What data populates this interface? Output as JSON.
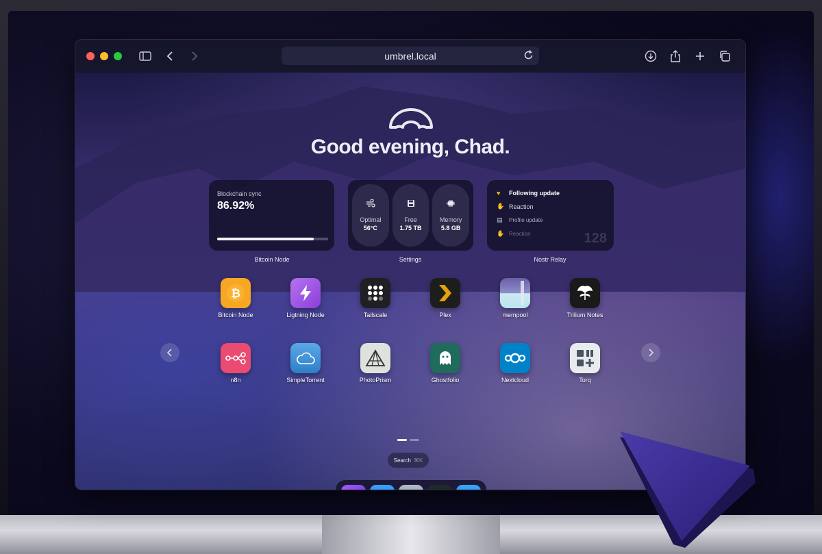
{
  "browser": {
    "url": "umbrel.local"
  },
  "greeting": "Good evening, Chad.",
  "widgets": {
    "bitcoin": {
      "label": "Blockchain sync",
      "value": "86.92%",
      "progress": 0.8692,
      "caption": "Bitcoin Node"
    },
    "settings": {
      "caption": "Settings",
      "pills": [
        {
          "label": "Optimal",
          "value": "56°C",
          "icon": "fan-icon"
        },
        {
          "label": "Free",
          "value": "1.75 TB",
          "icon": "disk-icon"
        },
        {
          "label": "Memory",
          "value": "5.8 GB",
          "icon": "memory-icon"
        }
      ]
    },
    "nostr": {
      "caption": "Nostr Relay",
      "count": "128",
      "items": [
        {
          "label": "Following update",
          "icon": "heart-icon"
        },
        {
          "label": "Reaction",
          "icon": "thumbs-up-icon"
        },
        {
          "label": "Profile update",
          "icon": "document-icon"
        },
        {
          "label": "Reaction",
          "icon": "thumbs-up-icon"
        }
      ]
    }
  },
  "apps": [
    {
      "name": "Bitcoin Node",
      "icon": "bitcoin-icon",
      "color": "#f7a723"
    },
    {
      "name": "Ligtning Node",
      "icon": "lightning-icon",
      "color": "#a25ae6"
    },
    {
      "name": "Tailscale",
      "icon": "tailscale-icon",
      "color": "#1f1f24"
    },
    {
      "name": "Plex",
      "icon": "plex-icon",
      "color": "#1d1d1d"
    },
    {
      "name": "mempool",
      "icon": "mempool-icon",
      "color": "#6e6fa8"
    },
    {
      "name": "Trilium Notes",
      "icon": "trilium-icon",
      "color": "#1a1a1a"
    },
    {
      "name": "n8n",
      "icon": "n8n-icon",
      "color": "#ea4b71"
    },
    {
      "name": "SimpleTorrent",
      "icon": "cloud-icon",
      "color": "#3f8fd6"
    },
    {
      "name": "PhotoPrism",
      "icon": "photoprism-icon",
      "color": "#d9dcd6"
    },
    {
      "name": "Ghostfolio",
      "icon": "ghost-icon",
      "color": "#1f6b5c"
    },
    {
      "name": "Nextcloud",
      "icon": "nextcloud-icon",
      "color": "#0082c9"
    },
    {
      "name": "Torq",
      "icon": "torq-icon",
      "color": "#e8ecef"
    }
  ],
  "search": {
    "label": "Search",
    "shortcut": "⌘K"
  },
  "dock": [
    {
      "icon": "home-icon",
      "color": "#8a3df0",
      "active": true
    },
    {
      "icon": "app-store-icon",
      "color": "#2d8cf0",
      "active": false
    },
    {
      "icon": "settings-sliders-icon",
      "color": "#8e95a6",
      "active": false
    },
    {
      "icon": "activity-monitor-icon",
      "color": "#1f2a2a",
      "active": false
    },
    {
      "icon": "widgets-icon",
      "color": "#1c7fd8",
      "active": false
    }
  ]
}
